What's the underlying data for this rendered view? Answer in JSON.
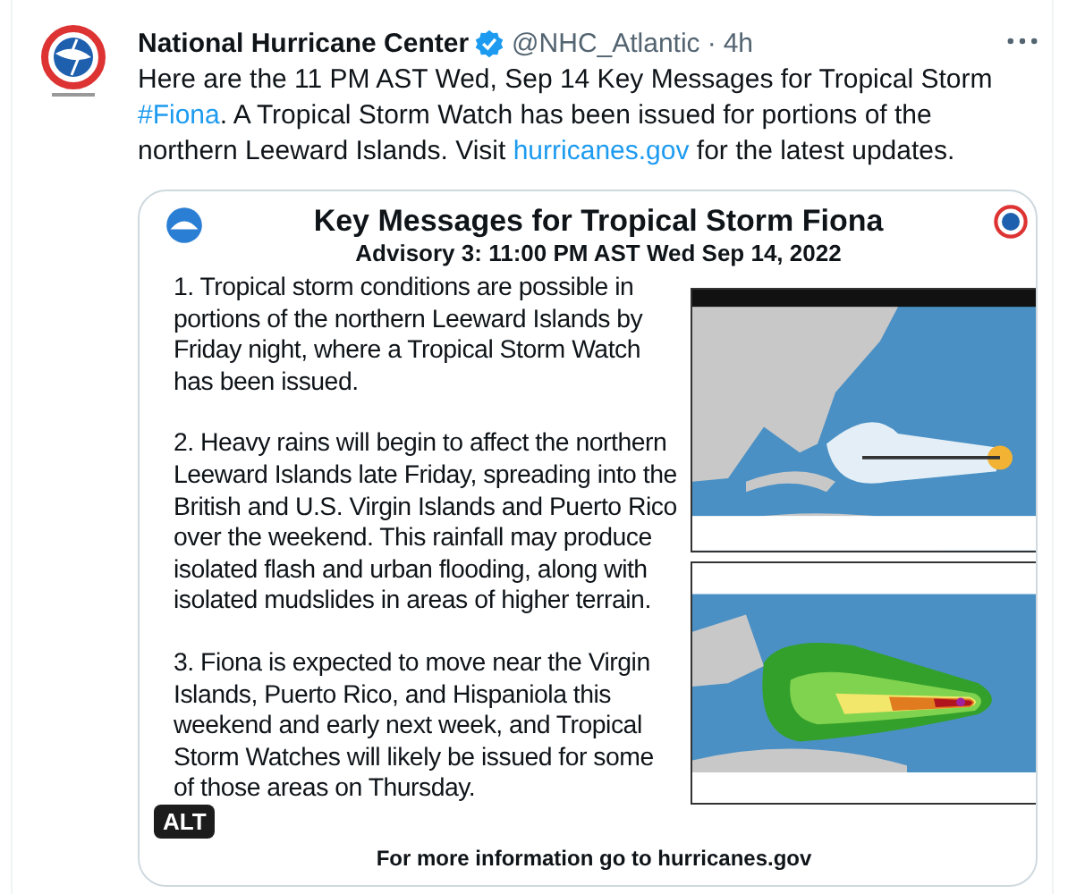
{
  "tweet": {
    "author": "National Hurricane Center",
    "handle": "@NHC_Atlantic",
    "separator": "·",
    "time": "4h",
    "body": [
      {
        "kind": "text",
        "text": "Here are the 11 PM AST Wed, Sep 14 Key Messages for  Tropical Storm "
      },
      {
        "kind": "link",
        "text": "#Fiona"
      },
      {
        "kind": "text",
        "text": ". A Tropical Storm Watch has been issued for portions of the northern Leeward Islands. Visit "
      },
      {
        "kind": "link",
        "text": "hurricanes.gov"
      },
      {
        "kind": "text",
        "text": " for the latest updates."
      }
    ]
  },
  "image": {
    "title": "Key Messages for Tropical Storm Fiona",
    "subtitle": "Advisory 3:  11:00 PM AST Wed Sep 14, 2022",
    "paragraphs": [
      "1. Tropical storm conditions are possible in portions of the northern Leeward Islands by Friday night, where a Tropical Storm Watch has been issued.",
      "2. Heavy rains will begin to affect the northern Leeward Islands late Friday, spreading into the British and U.S. Virgin Islands and Puerto Rico over the weekend. This rainfall may produce isolated flash and urban flooding, along with isolated mudslides in areas of higher terrain.",
      "3. Fiona is expected to move near the Virgin Islands, Puerto Rico, and Hispaniola this weekend and early next week, and Tropical Storm Watches will likely be issued for some of those areas on Thursday."
    ],
    "footer": "For more information go to hurricanes.gov",
    "alt_badge": "ALT"
  }
}
